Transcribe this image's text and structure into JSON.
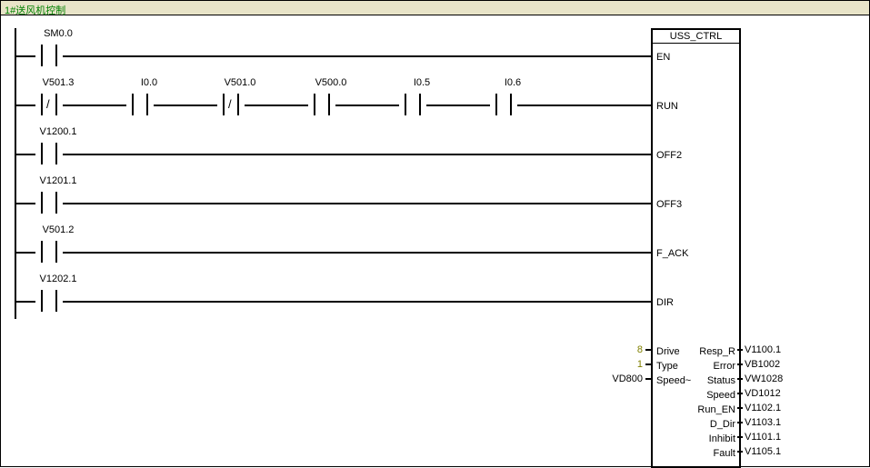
{
  "title": "1#送风机控制",
  "block": {
    "name": "USS_CTRL",
    "inputs": [
      {
        "pin": "EN"
      },
      {
        "pin": "RUN"
      },
      {
        "pin": "OFF2"
      },
      {
        "pin": "OFF3"
      },
      {
        "pin": "F_ACK"
      },
      {
        "pin": "DIR"
      },
      {
        "pin": "Drive",
        "val": "8",
        "olive": true
      },
      {
        "pin": "Type",
        "val": "1",
        "olive": true
      },
      {
        "pin": "Speed~",
        "val": "VD800"
      }
    ],
    "outputs": [
      {
        "pin": "Resp_R",
        "val": "V1100.1"
      },
      {
        "pin": "Error",
        "val": "VB1002"
      },
      {
        "pin": "Status",
        "val": "VW1028"
      },
      {
        "pin": "Speed",
        "val": "VD1012"
      },
      {
        "pin": "Run_EN",
        "val": "V1102.1"
      },
      {
        "pin": "D_Dir",
        "val": "V1103.1"
      },
      {
        "pin": "Inhibit",
        "val": "V1101.1"
      },
      {
        "pin": "Fault",
        "val": "V1105.1"
      }
    ]
  },
  "rungs": {
    "en": [
      {
        "label": "SM0.0",
        "type": "no"
      }
    ],
    "run": [
      {
        "label": "V501.3",
        "type": "nc"
      },
      {
        "label": "I0.0",
        "type": "no"
      },
      {
        "label": "V501.0",
        "type": "nc"
      },
      {
        "label": "V500.0",
        "type": "no"
      },
      {
        "label": "I0.5",
        "type": "no"
      },
      {
        "label": "I0.6",
        "type": "no"
      }
    ],
    "off2": [
      {
        "label": "V1200.1",
        "type": "no"
      }
    ],
    "off3": [
      {
        "label": "V1201.1",
        "type": "no"
      }
    ],
    "fack": [
      {
        "label": "V501.2",
        "type": "no"
      }
    ],
    "dir": [
      {
        "label": "V1202.1",
        "type": "no"
      }
    ]
  }
}
